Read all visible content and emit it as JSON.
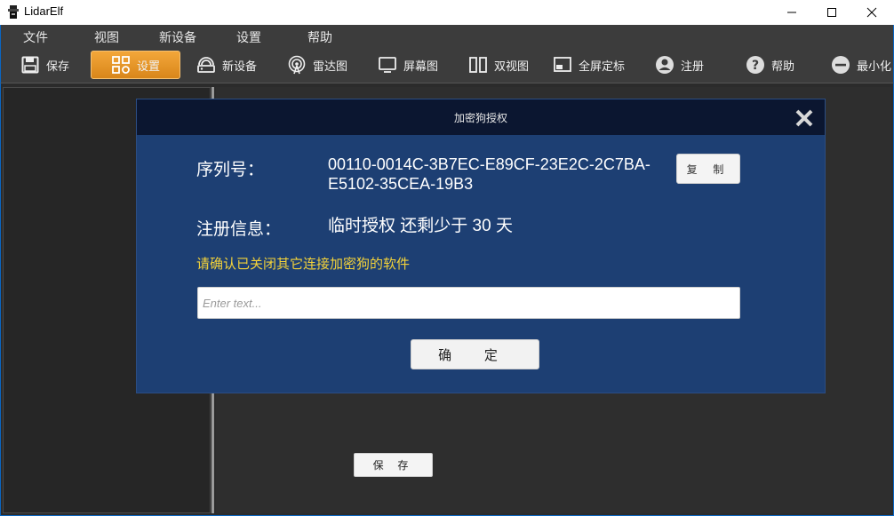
{
  "window": {
    "title": "LidarElf",
    "icon": "lidar-app-icon",
    "controls": [
      "minimize-icon",
      "maximize-icon",
      "close-icon"
    ]
  },
  "menubar": {
    "items": [
      {
        "label": "文件"
      },
      {
        "label": "视图"
      },
      {
        "label": "新设备"
      },
      {
        "label": "设置"
      },
      {
        "label": "帮助"
      }
    ]
  },
  "toolbar": {
    "active_index": 1,
    "accent": "#e79a2a",
    "items": [
      {
        "label": "保存",
        "icon": "save-icon"
      },
      {
        "label": "设置",
        "icon": "settings-grid-icon"
      },
      {
        "label": "新设备",
        "icon": "device-icon"
      },
      {
        "label": "雷达图",
        "icon": "radar-icon"
      },
      {
        "label": "屏幕图",
        "icon": "screen-icon"
      },
      {
        "label": "双视图",
        "icon": "dual-view-icon"
      },
      {
        "label": "全屏定标",
        "icon": "fullscreen-calibrate-icon"
      },
      {
        "label": "注册",
        "icon": "user-icon"
      },
      {
        "label": "帮助",
        "icon": "help-icon"
      },
      {
        "label": "最小化",
        "icon": "minimize-circle-icon"
      }
    ]
  },
  "workspace": {
    "save_button": "保 存"
  },
  "dialog": {
    "title": "加密狗授权",
    "serial_label": "序列号：",
    "serial_value": "00110-0014C-3B7EC-E89CF-23E2C-2C7BA-E5102-35CEA-19B3",
    "copy_button": "复 制",
    "register_label": "注册信息：",
    "register_value": "临时授权 还剩少于 30 天",
    "warning": "请确认已关闭其它连接加密狗的软件",
    "warning_color": "#f3d23a",
    "input_placeholder": "Enter text...",
    "input_value": "",
    "ok_button": "确 定",
    "background": "#1d3f73"
  }
}
